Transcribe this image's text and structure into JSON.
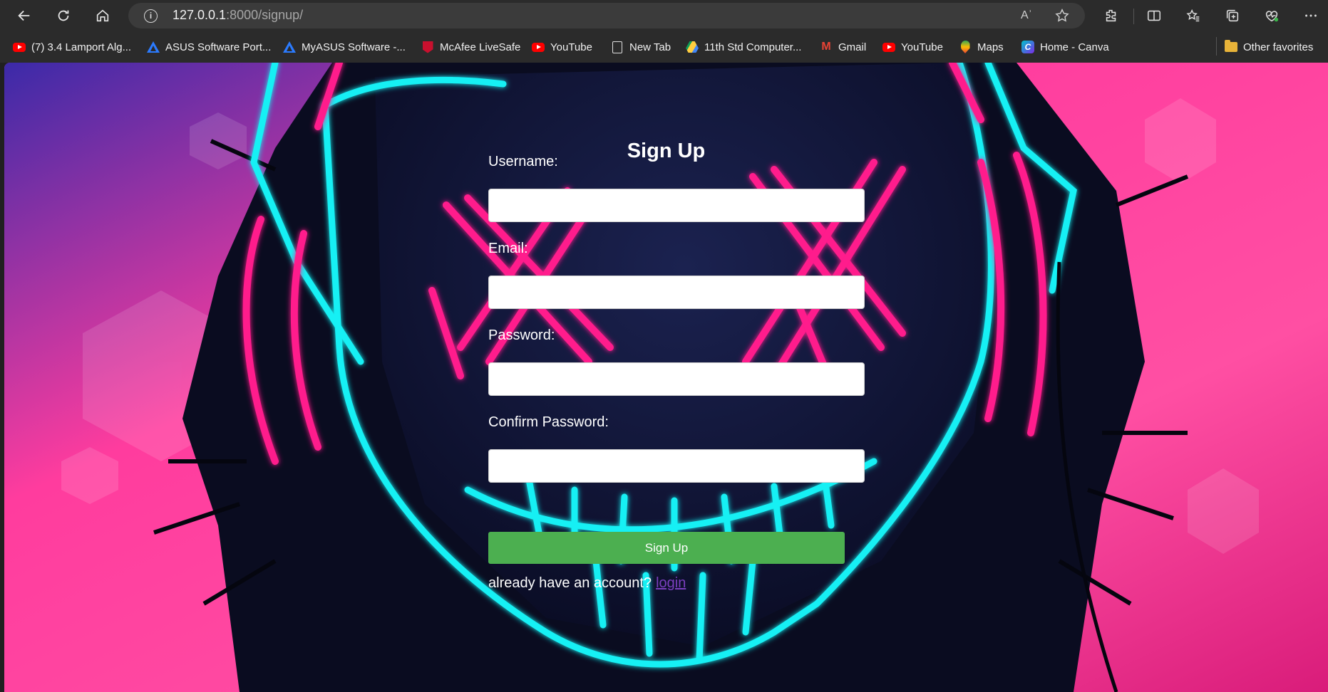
{
  "browser": {
    "url_host": "127.0.0.1",
    "url_path": ":8000/signup/",
    "icons": {
      "back": "back-arrow-icon",
      "refresh": "refresh-icon",
      "home": "home-icon",
      "site_info": "info-icon",
      "read_aloud": "read-aloud-icon",
      "favorite": "star-icon",
      "extensions": "puzzle-icon",
      "split_screen": "split-screen-icon",
      "favorites": "favorites-icon",
      "collections": "collections-icon",
      "health": "browser-essentials-icon",
      "menu": "more-icon"
    },
    "info_glyph": "i",
    "read_aloud_glyph": "Aʾ"
  },
  "bookmarks": [
    {
      "label": "(7) 3.4 Lamport Alg...",
      "icon": "youtube-icon"
    },
    {
      "label": "ASUS Software Port...",
      "icon": "asus-icon"
    },
    {
      "label": "MyASUS Software -...",
      "icon": "asus-icon"
    },
    {
      "label": "McAfee LiveSafe",
      "icon": "mcafee-icon"
    },
    {
      "label": "YouTube",
      "icon": "youtube-icon"
    },
    {
      "label": "New Tab",
      "icon": "page-icon"
    },
    {
      "label": "11th Std Computer...",
      "icon": "google-drive-icon"
    },
    {
      "label": "Gmail",
      "icon": "gmail-icon"
    },
    {
      "label": "YouTube",
      "icon": "youtube-icon"
    },
    {
      "label": "Maps",
      "icon": "maps-icon"
    },
    {
      "label": "Home - Canva",
      "icon": "canva-icon"
    }
  ],
  "other_favorites": {
    "label": "Other favorites",
    "icon": "folder-icon"
  },
  "icon_glyphs": {
    "gmail": "M",
    "canva": "C"
  },
  "form": {
    "title": "Sign Up",
    "username_label": "Username:",
    "email_label": "Email:",
    "password_label": "Password:",
    "confirm_label": "Confirm Password:",
    "username_value": "",
    "email_value": "",
    "password_value": "",
    "confirm_value": "",
    "submit_label": "Sign Up",
    "footer_text": "already have an account?",
    "login_link": "login"
  },
  "colors": {
    "submit_bg": "#4caf50",
    "neon_cyan": "#19f0f4",
    "neon_pink": "#ff1a8c",
    "background_pink": "#ff4fa3",
    "link": "#7b3fbf"
  }
}
